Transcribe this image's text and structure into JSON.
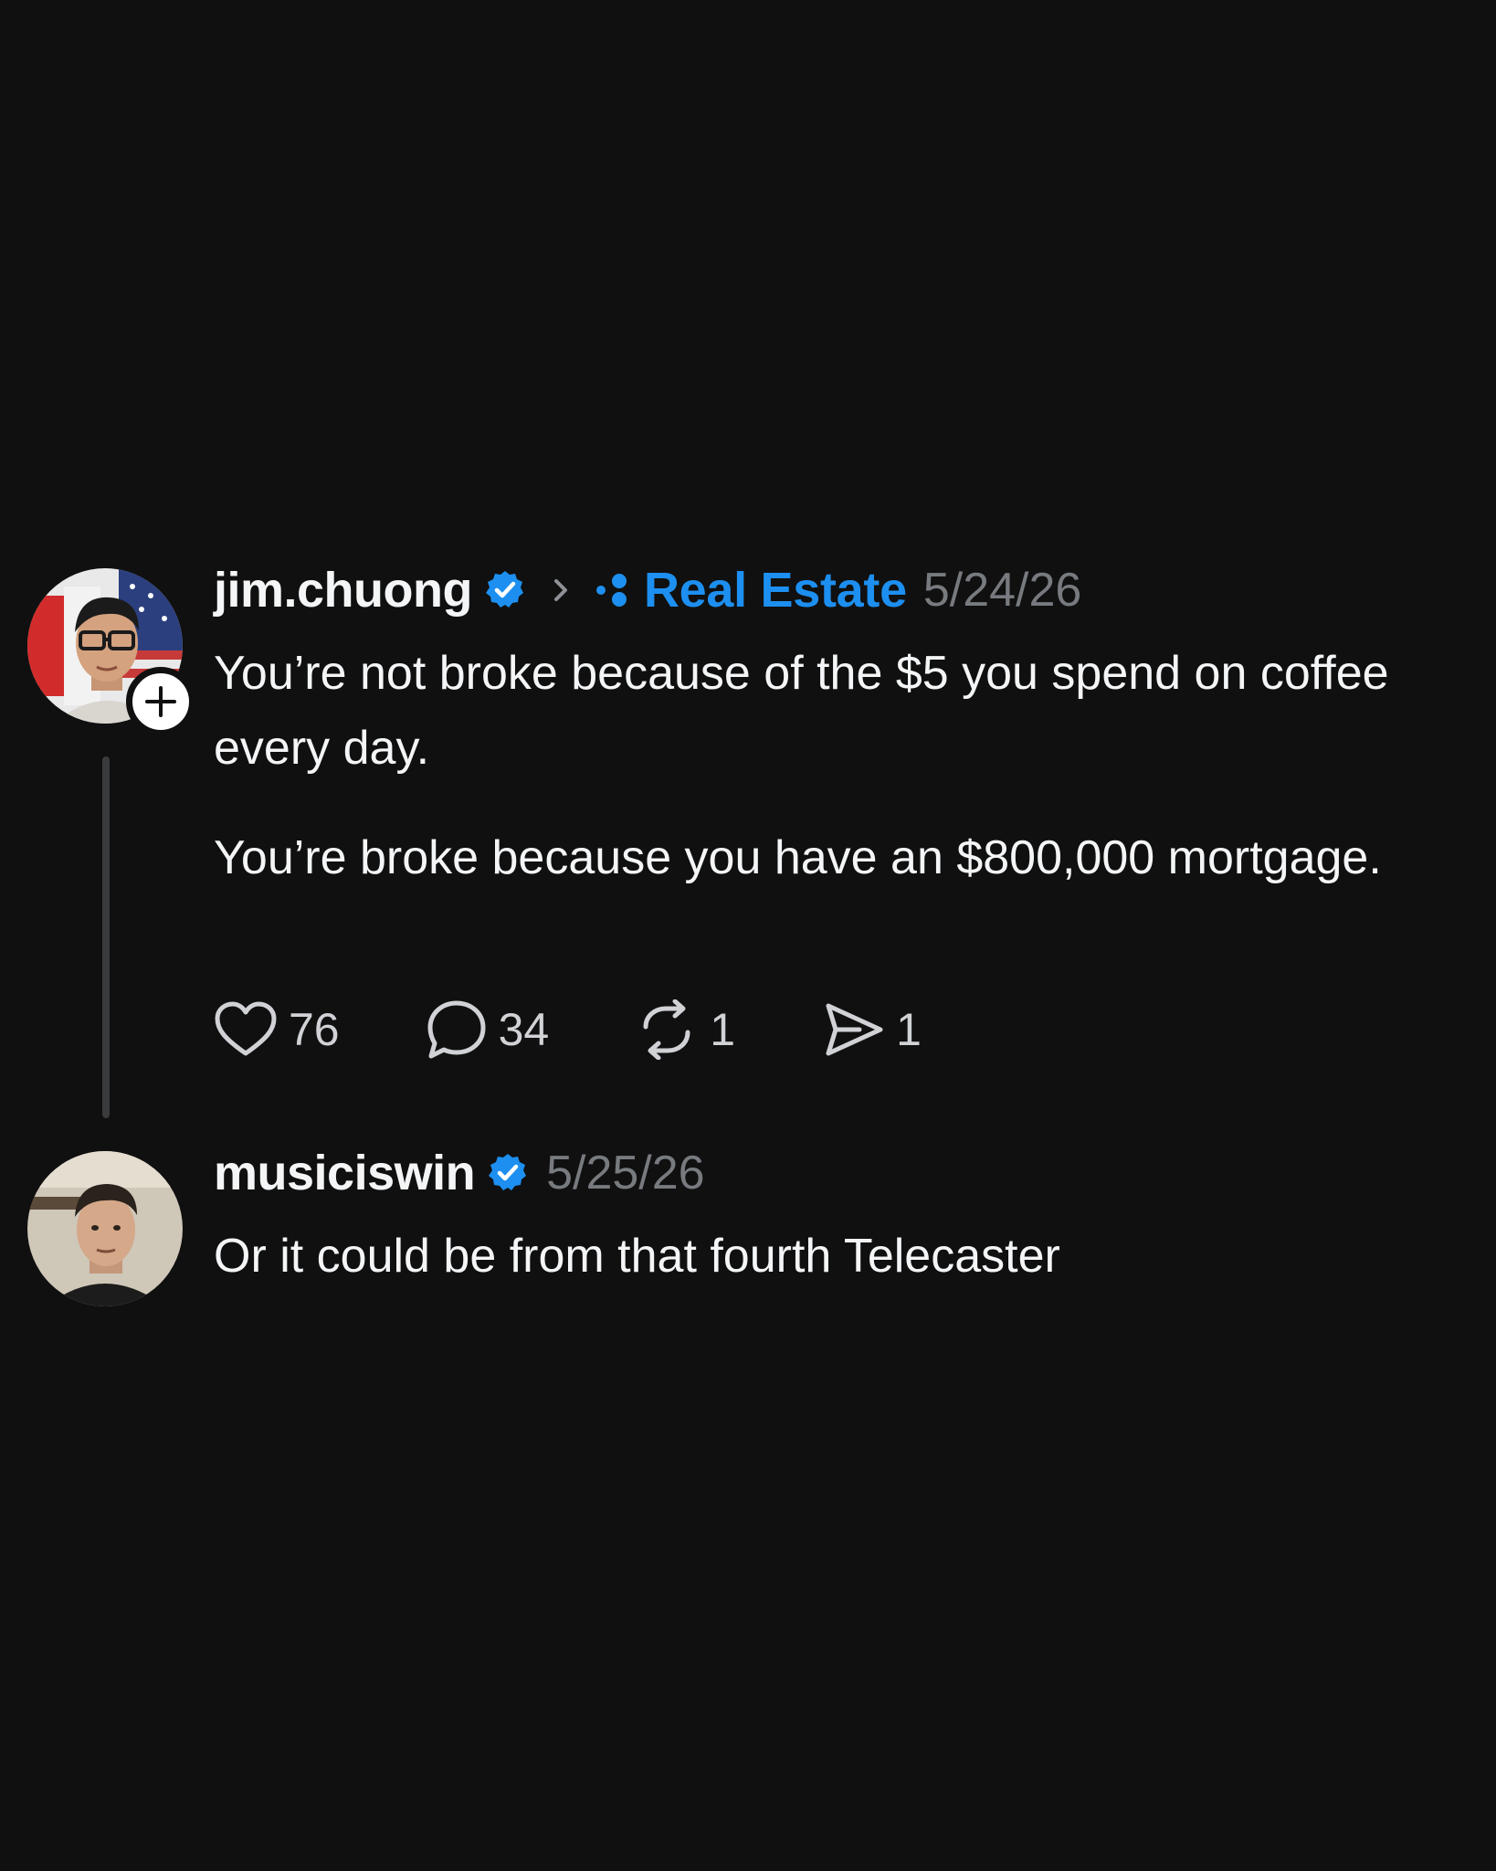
{
  "post": {
    "username": "jim.chuong",
    "topic": "Real Estate",
    "date": "5/24/26",
    "paragraph1": "You’re not broke because of the $5 you spend on coffee every day.",
    "paragraph2": "You’re broke because you have an $800,000 mortgage.",
    "likes": "76",
    "comments": "34",
    "reposts": "1",
    "shares": "1"
  },
  "reply": {
    "username": "musiciswin",
    "date": "5/25/26",
    "text": "Or it could be from that fourth Telecaster"
  },
  "colors": {
    "background": "#101010",
    "text": "#f3f5f7",
    "accent": "#1d8ff0",
    "muted": "#777a7f",
    "thread_line": "#3a3b3d"
  },
  "icons": [
    "verified-badge-icon",
    "chevron-right-icon",
    "topic-icon",
    "plus-icon",
    "heart-icon",
    "comment-icon",
    "repost-icon",
    "share-icon"
  ]
}
